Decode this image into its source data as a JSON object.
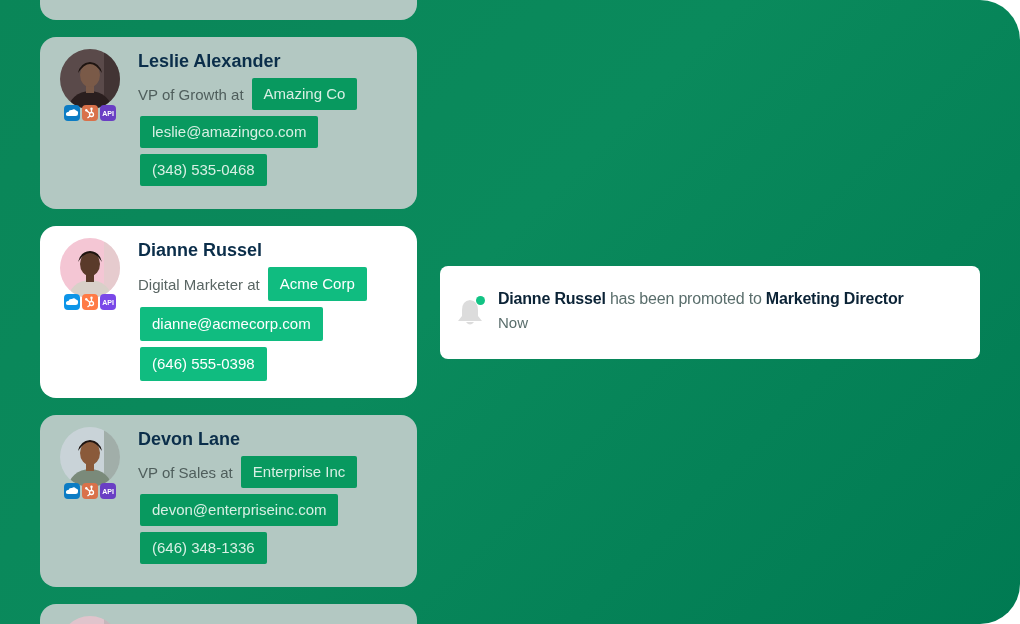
{
  "contacts": [
    {
      "kind": "stub",
      "highlighted": false
    },
    {
      "kind": "contact",
      "highlighted": false,
      "name": "Leslie Alexander",
      "role": "VP of Growth at",
      "company": "Amazing Co",
      "email": "leslie@amazingco.com",
      "phone": "(348) 535-0468",
      "api_badge": "API"
    },
    {
      "kind": "contact",
      "highlighted": true,
      "name": "Dianne Russel",
      "role": "Digital Marketer at",
      "company": "Acme Corp",
      "email": "dianne@acmecorp.com",
      "phone": "(646) 555-0398",
      "api_badge": "API"
    },
    {
      "kind": "contact",
      "highlighted": false,
      "name": "Devon Lane",
      "role": "VP of Sales at",
      "company": "Enterprise Inc",
      "email": "devon@enterpriseinc.com",
      "phone": "(646) 348-1336",
      "api_badge": "API"
    },
    {
      "kind": "stub",
      "highlighted": false
    }
  ],
  "notification": {
    "message": "**Dianne Russel** has been promoted to **Marketing Director**",
    "time": "Now",
    "unread": true
  }
}
